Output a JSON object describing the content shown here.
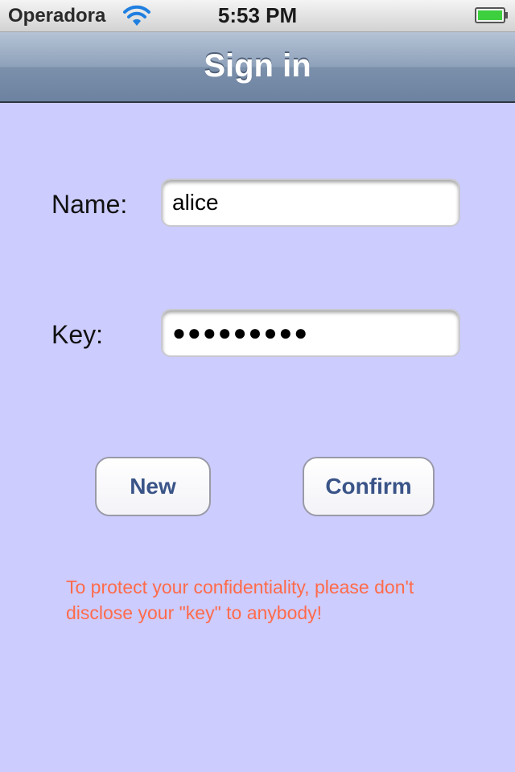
{
  "status_bar": {
    "carrier": "Operadora",
    "time": "5:53 PM",
    "wifi_icon": "wifi-icon",
    "battery_icon": "battery-icon",
    "battery_color": "#3ecf3e"
  },
  "nav_bar": {
    "title": "Sign in"
  },
  "form": {
    "name_label": "Name:",
    "name_value": "alice",
    "key_label": "Key:",
    "key_value_masked": "●●●●●●●●●"
  },
  "buttons": {
    "new_label": "New",
    "confirm_label": "Confirm"
  },
  "warning": {
    "line1": "To protect your confidentiality, please don't",
    "line2": "disclose your \"key\" to anybody!",
    "color": "#ff6b4a"
  },
  "colors": {
    "background": "#ccccff",
    "button_text": "#3a5488"
  }
}
